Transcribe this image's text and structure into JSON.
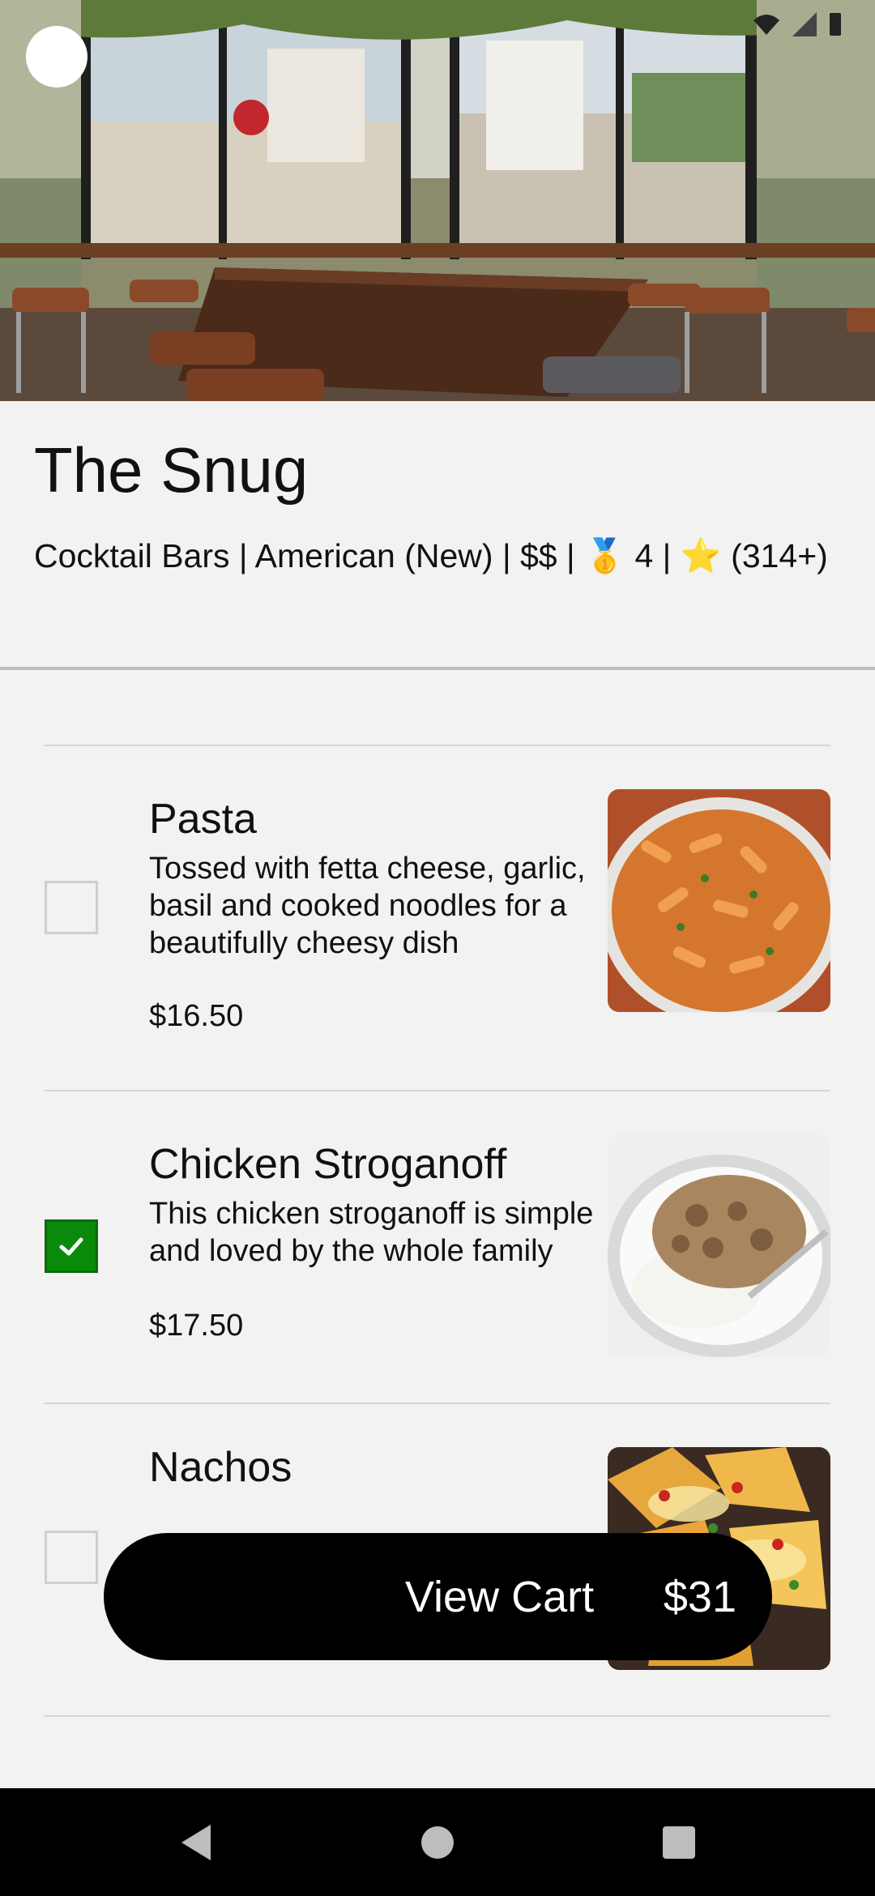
{
  "restaurant": {
    "name": "The Snug",
    "subtitle": "Cocktail Bars | American (New)  | $$ | 🥇 4 | ⭐ (314+)"
  },
  "menu": {
    "items": [
      {
        "title": "Pasta",
        "description": "Tossed with fetta cheese, garlic, basil and cooked noodles for a beautifully cheesy dish",
        "price": "$16.50",
        "checked": false,
        "photo_icon": "pasta-photo"
      },
      {
        "title": "Chicken Stroganoff",
        "description": "This chicken stroganoff is simple and loved by the whole family",
        "price": "$17.50",
        "checked": true,
        "photo_icon": "stroganoff-photo"
      },
      {
        "title": "Nachos",
        "description": "",
        "price": "",
        "checked": false,
        "photo_icon": "nachos-photo"
      }
    ]
  },
  "cart": {
    "label": "View Cart",
    "total": "$31"
  },
  "colors": {
    "check_green": "#0a8a0a",
    "cart_bg": "#000000"
  },
  "navigation": {
    "icons": [
      "back-triangle-icon",
      "home-circle-icon",
      "recents-square-icon"
    ]
  }
}
